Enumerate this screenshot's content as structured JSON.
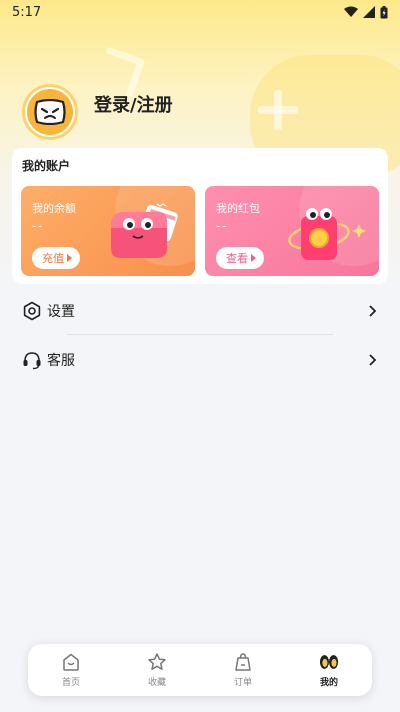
{
  "status_bar": {
    "time": "5:17"
  },
  "profile": {
    "login_label": "登录/注册"
  },
  "account": {
    "title": "我的账户",
    "balance": {
      "label": "我的余额",
      "value": "--",
      "button": "充值"
    },
    "red_packet": {
      "label": "我的红包",
      "value": "--",
      "button": "查看"
    }
  },
  "menu": [
    {
      "label": "设置",
      "icon": "settings-icon"
    },
    {
      "label": "客服",
      "icon": "headset-icon"
    }
  ],
  "bottom_nav": [
    {
      "label": "首页",
      "icon": "home-icon"
    },
    {
      "label": "收藏",
      "icon": "star-icon"
    },
    {
      "label": "订单",
      "icon": "order-bag-icon"
    },
    {
      "label": "我的",
      "icon": "eyes-icon",
      "active": true
    }
  ],
  "colors": {
    "balance_card": "#f98f4c",
    "redpack_card": "#f7769b",
    "header_yellow": "#fde98a"
  }
}
